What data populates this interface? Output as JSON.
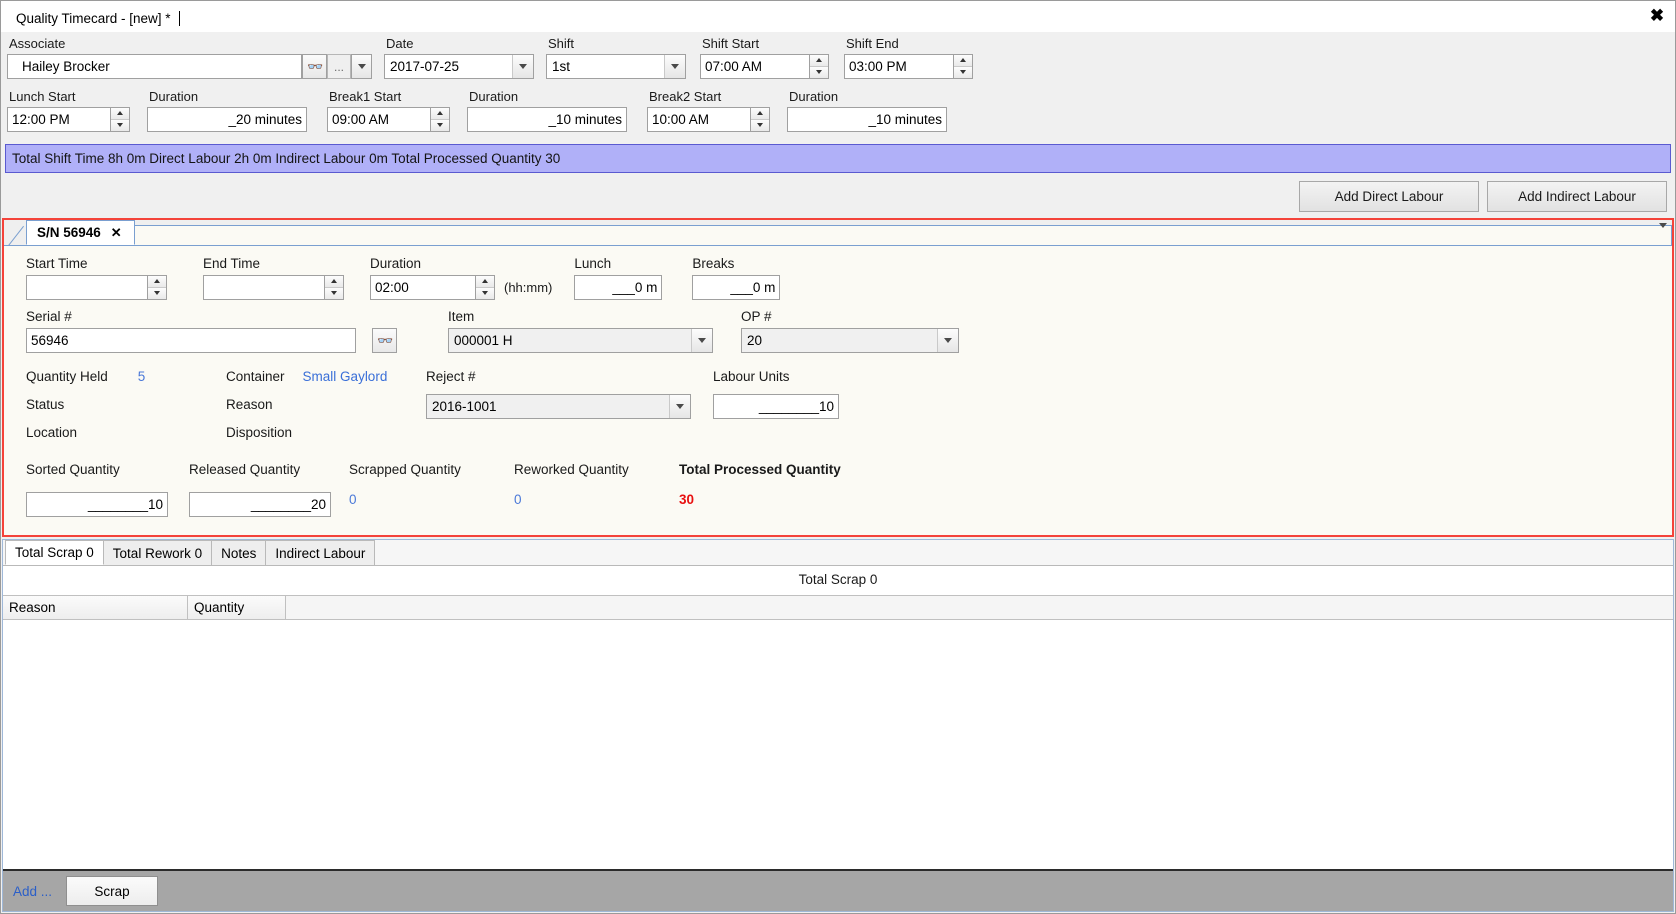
{
  "window": {
    "title": "Quality Timecard - [new] *",
    "close_label": "✖"
  },
  "header": {
    "associate": {
      "label": "Associate",
      "value": "Hailey Brocker",
      "search_icon": "binoculars-icon",
      "ellipsis_label": "...",
      "dropdown_icon": "chevron-down-icon"
    },
    "date": {
      "label": "Date",
      "value": "2017-07-25"
    },
    "shift": {
      "label": "Shift",
      "value": "1st"
    },
    "shift_start": {
      "label": "Shift Start",
      "value": "07:00 AM"
    },
    "shift_end": {
      "label": "Shift End",
      "value": "03:00 PM"
    },
    "lunch_start": {
      "label": "Lunch Start",
      "value": "12:00 PM"
    },
    "lunch_duration": {
      "label": "Duration",
      "value": "_20 minutes"
    },
    "break1_start": {
      "label": "Break1 Start",
      "value": "09:00 AM"
    },
    "break1_duration": {
      "label": "Duration",
      "value": "_10 minutes"
    },
    "break2_start": {
      "label": "Break2 Start",
      "value": "10:00 AM"
    },
    "break2_duration": {
      "label": "Duration",
      "value": "_10 minutes"
    }
  },
  "summary": {
    "text": "Total Shift Time 8h 0m  Direct Labour 2h 0m  Indirect Labour 0m  Total Processed Quantity 30",
    "accent_color": "#b0b0f8"
  },
  "actions": {
    "add_direct_labour": "Add Direct Labour",
    "add_indirect_labour": "Add Indirect Labour"
  },
  "detail": {
    "tab": {
      "label": "S/N 56946",
      "close": "✕"
    },
    "start_time": {
      "label": "Start Time",
      "value": ""
    },
    "end_time": {
      "label": "End Time",
      "value": ""
    },
    "duration": {
      "label": "Duration",
      "value": "02:00",
      "hint": "(hh:mm)"
    },
    "lunch": {
      "label": "Lunch",
      "value": "___0 m"
    },
    "breaks": {
      "label": "Breaks",
      "value": "___0 m"
    },
    "serial": {
      "label": "Serial #",
      "value": "56946",
      "search_icon": "binoculars-icon"
    },
    "item": {
      "label": "Item",
      "value": "000001 H"
    },
    "op": {
      "label": "OP #",
      "value": "20"
    },
    "quantity_held": {
      "label": "Quantity Held",
      "value": "5"
    },
    "container": {
      "label": "Container",
      "value": "Small Gaylord"
    },
    "reject": {
      "label": "Reject #",
      "value": "2016-1001"
    },
    "labour_units": {
      "label": "Labour Units",
      "value": "________10"
    },
    "status": {
      "label": "Status",
      "value": ""
    },
    "reason": {
      "label": "Reason",
      "value": ""
    },
    "location": {
      "label": "Location",
      "value": ""
    },
    "disposition": {
      "label": "Disposition",
      "value": ""
    },
    "sorted_quantity": {
      "label": "Sorted Quantity",
      "value": "________10"
    },
    "released_quantity": {
      "label": "Released Quantity",
      "value": "________20"
    },
    "scrapped_quantity": {
      "label": "Scrapped Quantity",
      "value": "0"
    },
    "reworked_quantity": {
      "label": "Reworked Quantity",
      "value": "0"
    },
    "total_processed_quantity": {
      "label": "Total Processed Quantity",
      "value": "30",
      "value_color": "#e81010"
    }
  },
  "bottom": {
    "tabs": [
      {
        "label": "Total Scrap 0",
        "active": true
      },
      {
        "label": "Total Rework 0",
        "active": false
      },
      {
        "label": "Notes",
        "active": false
      },
      {
        "label": "Indirect Labour",
        "active": false
      }
    ],
    "grid_title": "Total Scrap 0",
    "columns": [
      {
        "label": "Reason"
      },
      {
        "label": "Quantity"
      }
    ],
    "rows": []
  },
  "footer": {
    "add_label": "Add ...",
    "scrap_label": "Scrap"
  }
}
